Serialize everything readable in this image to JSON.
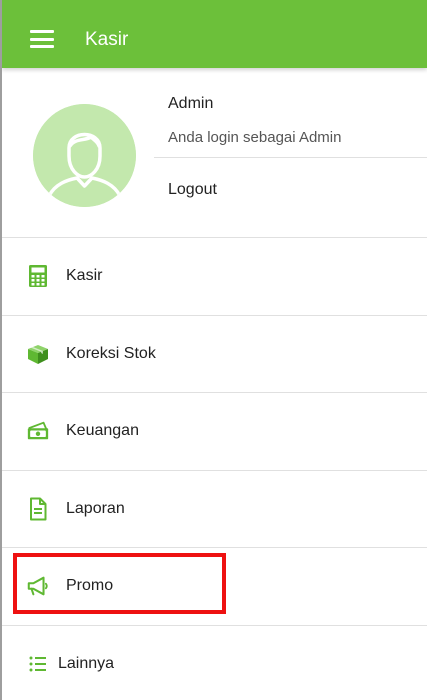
{
  "appbar": {
    "title": "Kasir",
    "menu_icon": "hamburger-icon",
    "color": "#6cc03a"
  },
  "profile": {
    "name": "Admin",
    "subtitle": "Anda login sebagai Admin",
    "logout_label": "Logout",
    "avatar_icon": "user-avatar-icon",
    "avatar_color": "#c3e8ad"
  },
  "menu": {
    "items": [
      {
        "label": "Kasir",
        "icon": "calculator-icon"
      },
      {
        "label": "Koreksi Stok",
        "icon": "box-icon"
      },
      {
        "label": "Keuangan",
        "icon": "money-icon"
      },
      {
        "label": "Laporan",
        "icon": "document-icon"
      },
      {
        "label": "Promo",
        "icon": "megaphone-icon"
      },
      {
        "label": "Lainnya",
        "icon": "list-icon"
      }
    ],
    "icon_color": "#5fb832"
  },
  "highlight": {
    "target": "Promo",
    "color": "#ee1111"
  }
}
